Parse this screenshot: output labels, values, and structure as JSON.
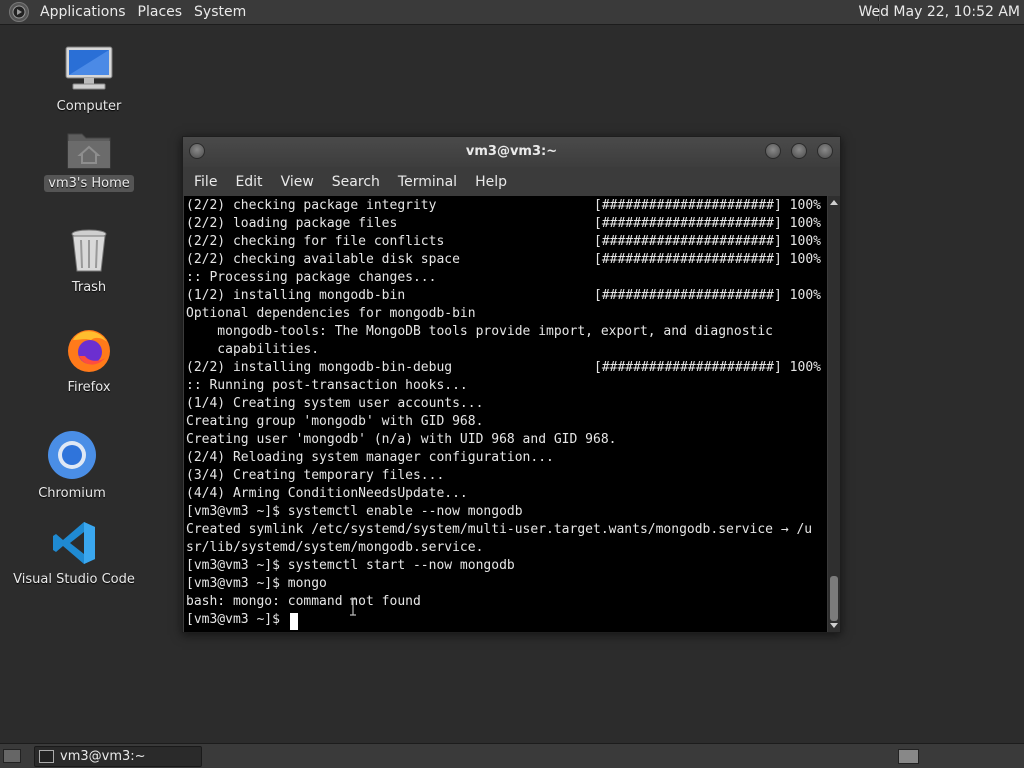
{
  "top_panel": {
    "menus": [
      "Applications",
      "Places",
      "System"
    ],
    "clock": "Wed May 22, 10:52 AM"
  },
  "desktop_icons": [
    {
      "label": "Computer",
      "icon": "computer-icon"
    },
    {
      "label": "vm3's Home",
      "icon": "home-folder-icon",
      "selected": true
    },
    {
      "label": "Trash",
      "icon": "trash-icon"
    },
    {
      "label": "Firefox",
      "icon": "firefox-icon"
    },
    {
      "label": "Chromium",
      "icon": "chromium-icon"
    },
    {
      "label": "Visual Studio Code",
      "icon": "vscode-icon"
    }
  ],
  "terminal": {
    "title": "vm3@vm3:~",
    "menus": [
      "File",
      "Edit",
      "View",
      "Search",
      "Terminal",
      "Help"
    ],
    "lines": [
      "(2/2) checking package integrity",
      "(2/2) loading package files",
      "(2/2) checking for file conflicts",
      "(2/2) checking available disk space",
      ":: Processing package changes...",
      "(1/2) installing mongodb-bin",
      "Optional dependencies for mongodb-bin",
      "    mongodb-tools: The MongoDB tools provide import, export, and diagnostic",
      "    capabilities.",
      "(2/2) installing mongodb-bin-debug",
      ":: Running post-transaction hooks...",
      "(1/4) Creating system user accounts...",
      "Creating group 'mongodb' with GID 968.",
      "Creating user 'mongodb' (n/a) with UID 968 and GID 968.",
      "(2/4) Reloading system manager configuration...",
      "(3/4) Creating temporary files...",
      "(4/4) Arming ConditionNeedsUpdate...",
      "[vm3@vm3 ~]$ systemctl enable --now mongodb",
      "Created symlink /etc/systemd/system/multi-user.target.wants/mongodb.service → /u",
      "sr/lib/systemd/system/mongodb.service.",
      "[vm3@vm3 ~]$ systemctl start --now mongodb",
      "[vm3@vm3 ~]$ mongo",
      "bash: mongo: command not found",
      "[vm3@vm3 ~]$ "
    ],
    "progress_bar_text": "[######################] 100%",
    "progress_bar_lines": [
      0,
      1,
      2,
      3,
      5,
      9
    ]
  },
  "taskbar": {
    "task_label": "vm3@vm3:~"
  },
  "colors": {
    "desktop_bg": "#2c2c2c",
    "panel_bg": "#3a3a3a",
    "terminal_bg": "#000000",
    "terminal_fg": "#e6e6e6"
  }
}
